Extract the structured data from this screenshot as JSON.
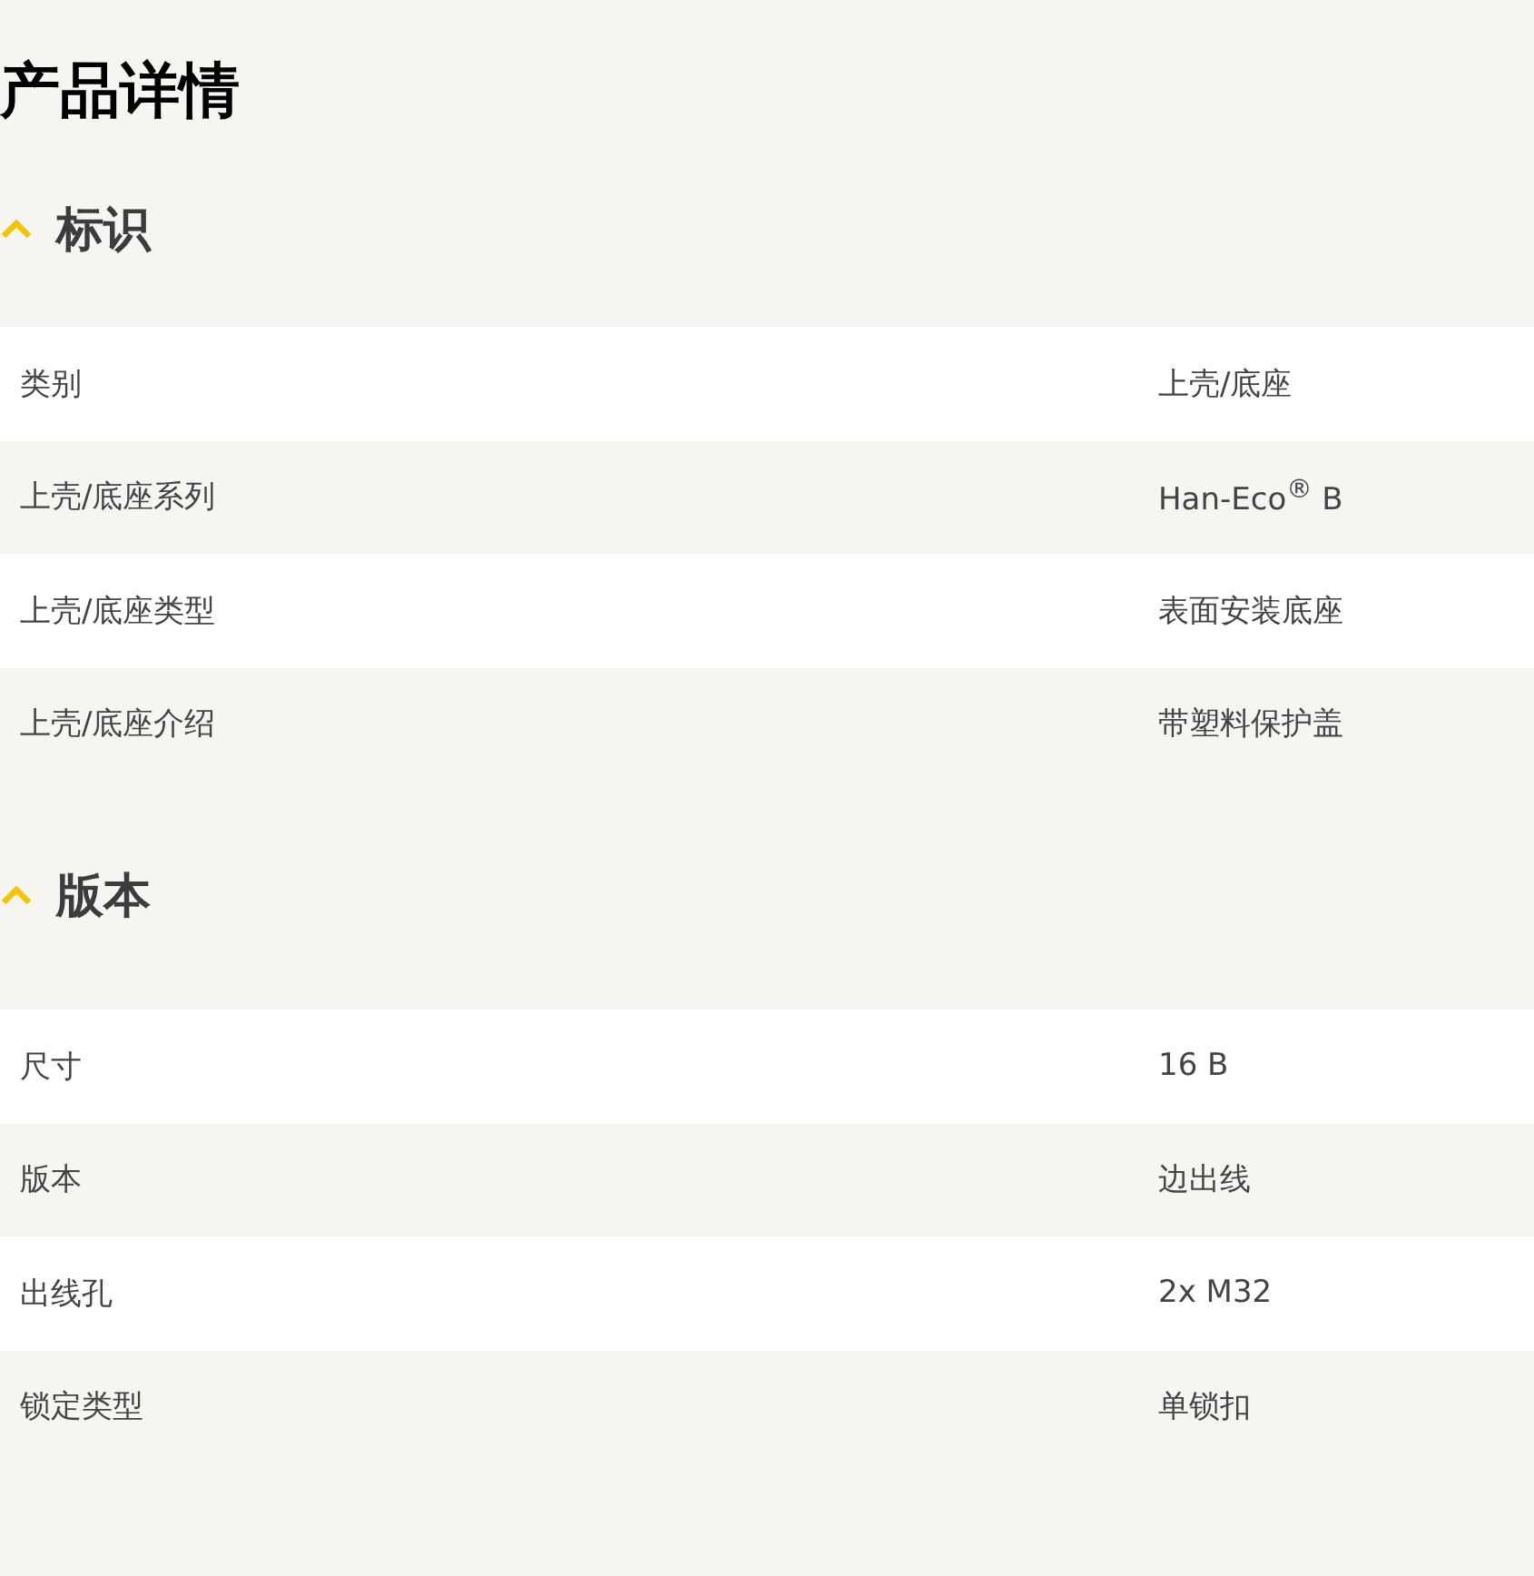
{
  "title": "产品详情",
  "sections": [
    {
      "heading": "标识",
      "expanded": true,
      "rows": [
        {
          "label": "类别",
          "value": "上壳/底座"
        },
        {
          "label": "上壳/底座系列",
          "value": "Han-Eco$^{®}$ B"
        },
        {
          "label": "上壳/底座类型",
          "value": "表面安装底座"
        },
        {
          "label": "上壳/底座介绍",
          "value": "带塑料保护盖"
        }
      ]
    },
    {
      "heading": "版本",
      "expanded": true,
      "rows": [
        {
          "label": "尺寸",
          "value": "16 B"
        },
        {
          "label": "版本",
          "value": "边出线"
        },
        {
          "label": "出线孔",
          "value": "2x M32"
        },
        {
          "label": "锁定类型",
          "value": "单锁扣"
        }
      ]
    }
  ]
}
